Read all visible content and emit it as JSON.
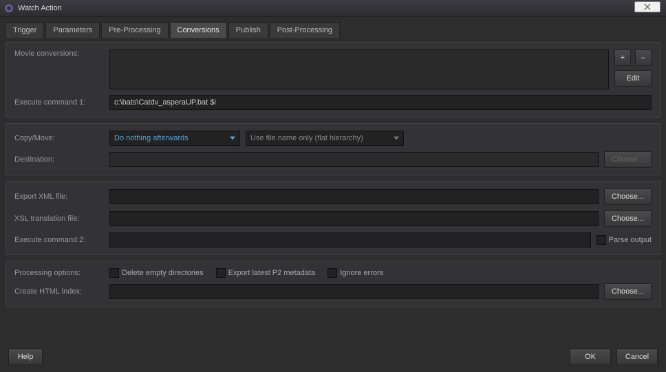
{
  "window": {
    "title": "Watch Action"
  },
  "tabs": [
    {
      "label": "Trigger"
    },
    {
      "label": "Parameters"
    },
    {
      "label": "Pre-Processing"
    },
    {
      "label": "Conversions"
    },
    {
      "label": "Publish"
    },
    {
      "label": "Post-Processing"
    }
  ],
  "conversions": {
    "movie_label": "Movie conversions:",
    "add_btn": "+",
    "remove_btn": "–",
    "edit_btn": "Edit",
    "exec1_label": "Execute command 1:",
    "exec1_value": "c:\\bats\\Catdv_asperaUP.bat $i"
  },
  "copymove": {
    "label": "Copy/Move:",
    "select_value": "Do nothing afterwards",
    "hierarchy_value": "Use file name only (flat hierarchy)",
    "dest_label": "Destination:",
    "choose": "Choose..."
  },
  "export": {
    "xml_label": "Export XML file:",
    "xsl_label": "XSL translation file:",
    "exec2_label": "Execute command 2:",
    "parse_label": "Parse output",
    "choose": "Choose..."
  },
  "processing": {
    "label": "Processing options:",
    "delete_empty": "Delete empty directories",
    "export_p2": "Export latest P2 metadata",
    "ignore_errors": "Ignore errors",
    "html_label": "Create HTML index:",
    "choose": "Choose..."
  },
  "footer": {
    "help": "Help",
    "ok": "OK",
    "cancel": "Cancel"
  }
}
